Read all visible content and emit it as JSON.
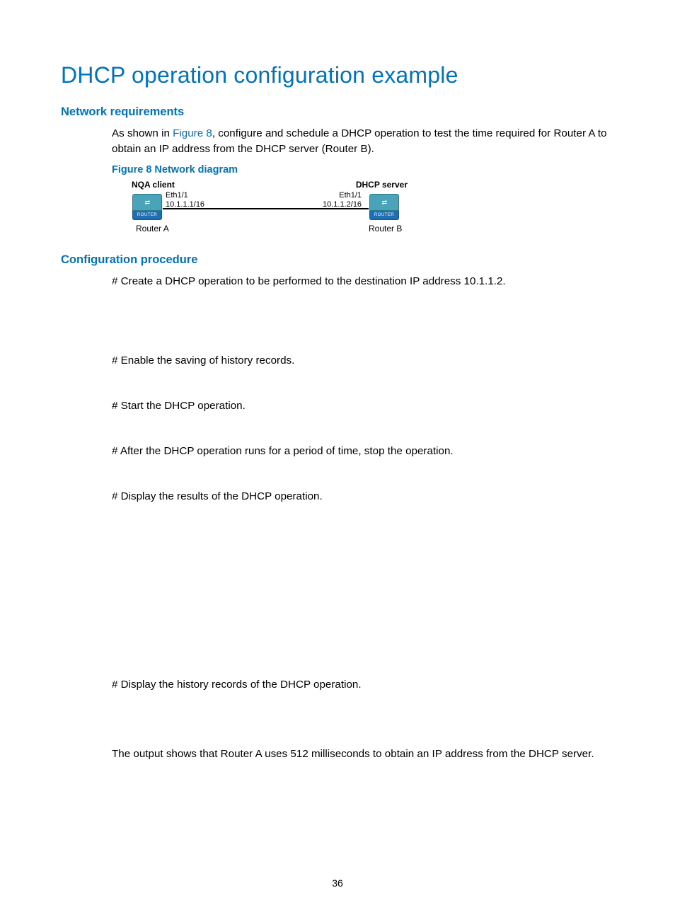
{
  "title": "DHCP operation configuration example",
  "sections": {
    "network_req_heading": "Network requirements",
    "intro_prefix": "As shown in ",
    "intro_link": "Figure 8",
    "intro_suffix": ", configure and schedule a DHCP operation to test the time required for Router A to obtain an IP address from the DHCP server (Router B).",
    "figure_caption": "Figure 8 Network diagram",
    "config_proc_heading": "Configuration procedure"
  },
  "diagram": {
    "client_label": "NQA client",
    "server_label": "DHCP server",
    "left_if": "Eth1/1",
    "left_ip": "10.1.1.1/16",
    "right_if": "Eth1/1",
    "right_ip": "10.1.1.2/16",
    "router_a": "Router A",
    "router_b": "Router B",
    "router_badge": "ROUTER",
    "arrows": "⇄"
  },
  "steps": {
    "s1": "# Create a DHCP operation to be performed to the destination IP address 10.1.1.2.",
    "s2": "# Enable the saving of history records.",
    "s3": "# Start the DHCP operation.",
    "s4": "# After the DHCP operation runs for a period of time, stop the operation.",
    "s5": "# Display the results of the DHCP operation.",
    "s6": "# Display the history records of the DHCP operation.",
    "conclusion": "The output shows that Router A uses 512 milliseconds to obtain an IP address from the DHCP server."
  },
  "page_number": "36"
}
